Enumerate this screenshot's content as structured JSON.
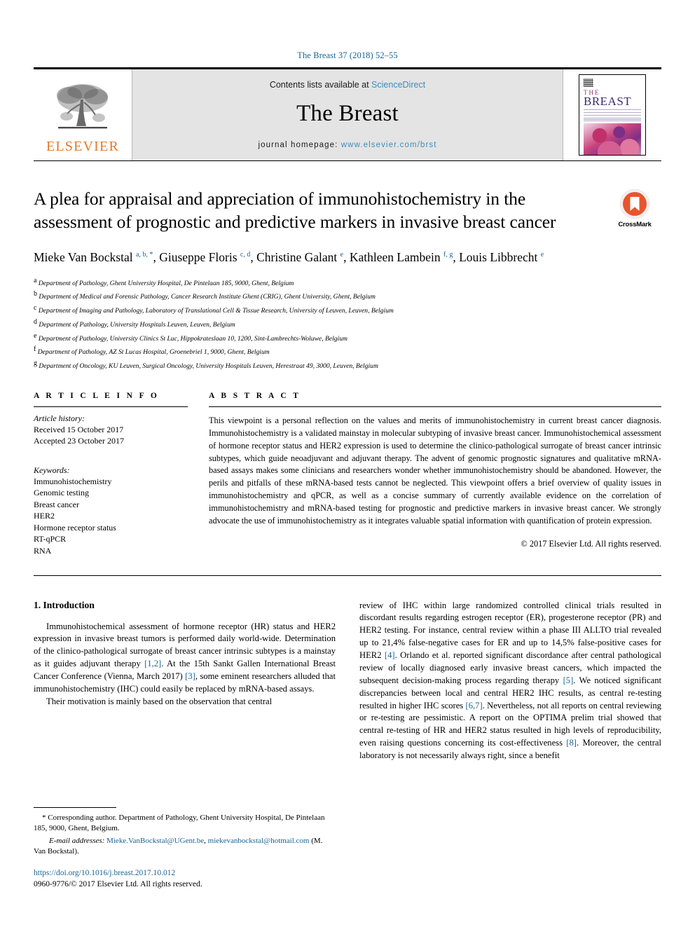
{
  "running_head": "The Breast 37 (2018) 52–55",
  "masthead": {
    "contents_prefix": "Contents lists available at ",
    "contents_link": "ScienceDirect",
    "journal_name": "The Breast",
    "homepage_prefix": "journal homepage: ",
    "homepage_url": "www.elsevier.com/brst",
    "publisher_logo_label": "ELSEVIER",
    "cover_the": "THE",
    "cover_breast": "BREAST"
  },
  "title": "A plea for appraisal and appreciation of immunohistochemistry in the assessment of prognostic and predictive markers in invasive breast cancer",
  "crossmark_label": "CrossMark",
  "authors": [
    {
      "name": "Mieke Van Bockstal",
      "sup": "a, b, *",
      "sep": ", "
    },
    {
      "name": "Giuseppe Floris",
      "sup": "c, d",
      "sep": ", "
    },
    {
      "name": "Christine Galant",
      "sup": "e",
      "sep": ", "
    },
    {
      "name": "Kathleen Lambein",
      "sup": "f, g",
      "sep": ", "
    },
    {
      "name": "Louis Libbrecht",
      "sup": "e",
      "sep": ""
    }
  ],
  "affiliations": [
    {
      "marker": "a",
      "text": "Department of Pathology, Ghent University Hospital, De Pintelaan 185, 9000, Ghent, Belgium"
    },
    {
      "marker": "b",
      "text": "Department of Medical and Forensic Pathology, Cancer Research Institute Ghent (CRIG), Ghent University, Ghent, Belgium"
    },
    {
      "marker": "c",
      "text": "Department of Imaging and Pathology, Laboratory of Translational Cell & Tissue Research, University of Leuven, Leuven, Belgium"
    },
    {
      "marker": "d",
      "text": "Department of Pathology, University Hospitals Leuven, Leuven, Belgium"
    },
    {
      "marker": "e",
      "text": "Department of Pathology, University Clinics St Luc, Hippokrateslaan 10, 1200, Sint-Lambrechts-Woluwe, Belgium"
    },
    {
      "marker": "f",
      "text": "Department of Pathology, AZ St Lucas Hospital, Groenebriel 1, 9000, Ghent, Belgium"
    },
    {
      "marker": "g",
      "text": "Department of Oncology, KU Leuven, Surgical Oncology, University Hospitals Leuven, Herestraat 49, 3000, Leuven, Belgium"
    }
  ],
  "article_info": {
    "heading": "A R T I C L E  I N F O",
    "history_label": "Article history:",
    "received": "Received 15 October 2017",
    "accepted": "Accepted 23 October 2017",
    "keywords_label": "Keywords:",
    "keywords": [
      "Immunohistochemistry",
      "Genomic testing",
      "Breast cancer",
      "HER2",
      "Hormone receptor status",
      "RT-qPCR",
      "RNA"
    ]
  },
  "abstract": {
    "heading": "A B S T R A C T",
    "text": "This viewpoint is a personal reflection on the values and merits of immunohistochemistry in current breast cancer diagnosis. Immunohistochemistry is a validated mainstay in molecular subtyping of invasive breast cancer. Immunohistochemical assessment of hormone receptor status and HER2 expression is used to determine the clinico-pathological surrogate of breast cancer intrinsic subtypes, which guide neoadjuvant and adjuvant therapy. The advent of genomic prognostic signatures and qualitative mRNA-based assays makes some clinicians and researchers wonder whether immunohistochemistry should be abandoned. However, the perils and pitfalls of these mRNA-based tests cannot be neglected. This viewpoint offers a brief overview of quality issues in immunohistochemistry and qPCR, as well as a concise summary of currently available evidence on the correlation of immunohistochemistry and mRNA-based testing for prognostic and predictive markers in invasive breast cancer. We strongly advocate the use of immunohistochemistry as it integrates valuable spatial information with quantification of protein expression.",
    "copyright": "© 2017 Elsevier Ltd. All rights reserved."
  },
  "body": {
    "section_number_title": "1. Introduction",
    "left_p1_a": "Immunohistochemical assessment of hormone receptor (HR) status and HER2 expression in invasive breast tumors is performed daily world-wide. Determination of the clinico-pathological surrogate of breast cancer intrinsic subtypes is a mainstay as it guides adjuvant therapy ",
    "left_p1_ref1": "[1,2]",
    "left_p1_b": ". At the 15th Sankt Gallen International Breast Cancer Conference (Vienna, March 2017) ",
    "left_p1_ref2": "[3]",
    "left_p1_c": ", some eminent researchers alluded that immunohistochemistry (IHC) could easily be replaced by mRNA-based assays.",
    "left_p2": "Their motivation is mainly based on the observation that central",
    "right_a": "review of IHC within large randomized controlled clinical trials resulted in discordant results regarding estrogen receptor (ER), progesterone receptor (PR) and HER2 testing. For instance, central review within a phase III ALLTO trial revealed up to 21,4% false-negative cases for ER and up to 14,5% false-positive cases for HER2 ",
    "right_ref4": "[4]",
    "right_b": ". Orlando et al. reported significant discordance after central pathological review of locally diagnosed early invasive breast cancers, which impacted the subsequent decision-making process regarding therapy ",
    "right_ref5": "[5]",
    "right_c": ". We noticed significant discrepancies between local and central HER2 IHC results, as central re-testing resulted in higher IHC scores ",
    "right_ref67": "[6,7]",
    "right_d": ". Nevertheless, not all reports on central reviewing or re-testing are pessimistic. A report on the OPTIMA prelim trial showed that central re-testing of HR and HER2 status resulted in high levels of reproducibility, even raising questions concerning its cost-effectiveness ",
    "right_ref8": "[8]",
    "right_e": ". Moreover, the central laboratory is not necessarily always right, since a benefit"
  },
  "footnotes": {
    "corresponding": "* Corresponding author. Department of Pathology, Ghent University Hospital, De Pintelaan 185, 9000, Ghent, Belgium.",
    "email_label": "E-mail addresses:",
    "email_1": "Mieke.VanBockstal@UGent.be",
    "email_2": "miekevanbockstal@hotmail.com",
    "email_owner": "(M. Van Bockstal).",
    "doi": "https://doi.org/10.1016/j.breast.2017.10.012",
    "issn_line": "0960-9776/© 2017 Elsevier Ltd. All rights reserved."
  }
}
